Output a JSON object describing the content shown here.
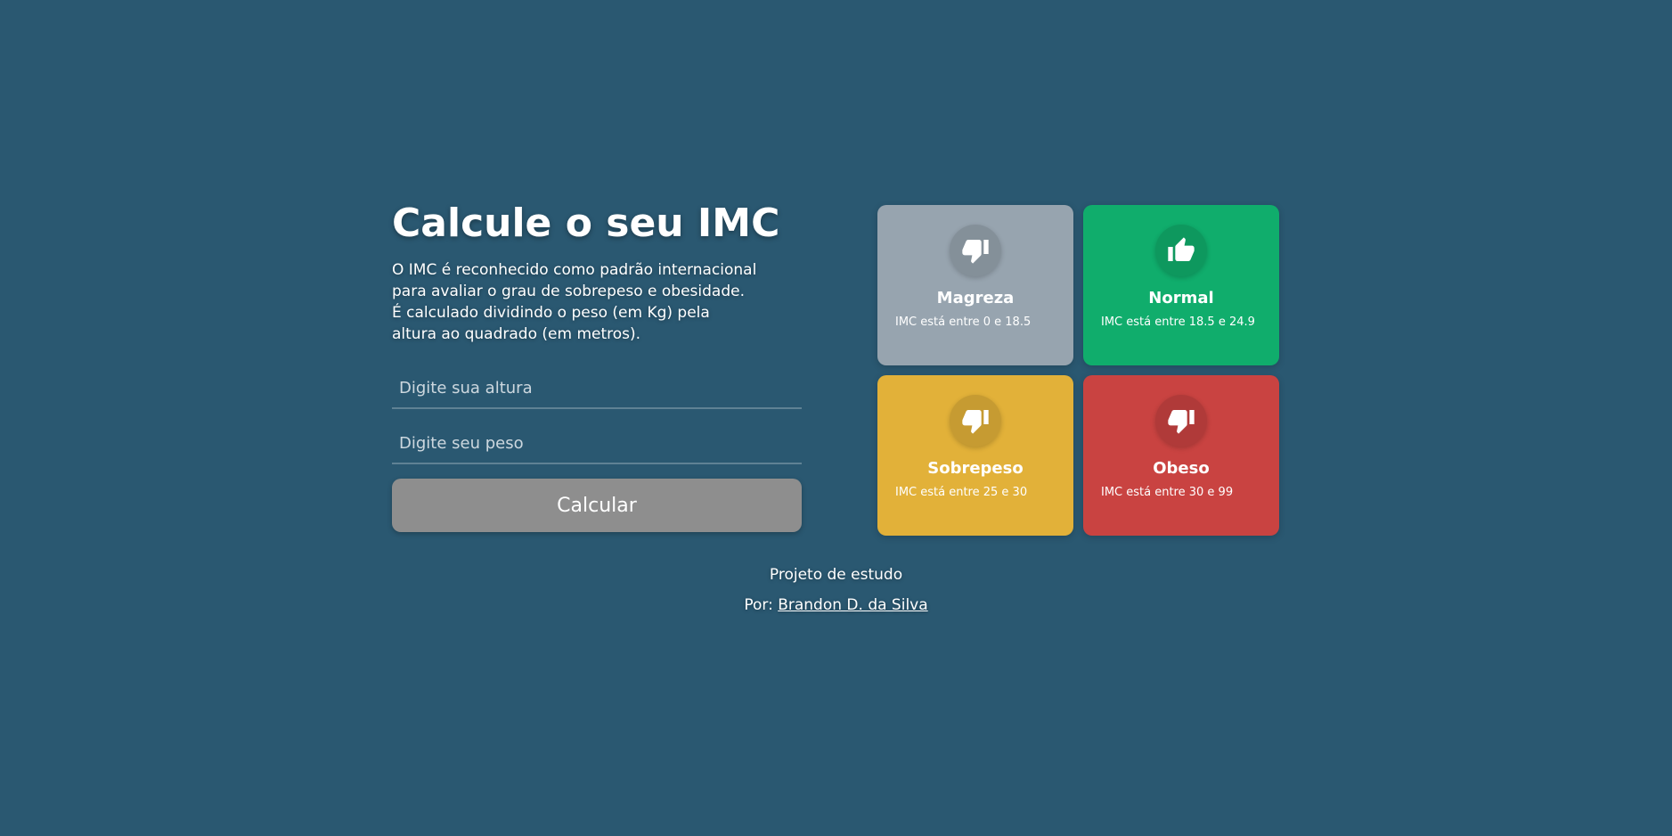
{
  "left": {
    "title": "Calcule o seu IMC",
    "description_lines": [
      "O IMC é reconhecido como padrão internacional",
      "para avaliar o grau de sobrepeso e obesidade.",
      "É calculado dividindo o peso (em Kg) pela",
      "altura ao quadrado (em metros)."
    ],
    "height_placeholder": "Digite sua altura",
    "weight_placeholder": "Digite seu peso",
    "button_label": "Calcular"
  },
  "cards": [
    {
      "title": "Magreza",
      "range": "IMC está entre 0 e 18.5",
      "icon": "thumbs-down-icon",
      "color": "#97a4af"
    },
    {
      "title": "Normal",
      "range": "IMC está entre 18.5 e 24.9",
      "icon": "thumbs-up-icon",
      "color": "#10ad6c"
    },
    {
      "title": "Sobrepeso",
      "range": "IMC está entre 25 e 30",
      "icon": "thumbs-down-icon",
      "color": "#e2b139"
    },
    {
      "title": "Obeso",
      "range": "IMC está entre 30 e 99",
      "icon": "thumbs-down-icon",
      "color": "#c94341"
    }
  ],
  "footer": {
    "line1": "Projeto de estudo",
    "by_prefix": "Por:",
    "author": "Brandon D. da Silva"
  },
  "colors": {
    "background": "#2a5871",
    "button": "#8e8e8e"
  }
}
